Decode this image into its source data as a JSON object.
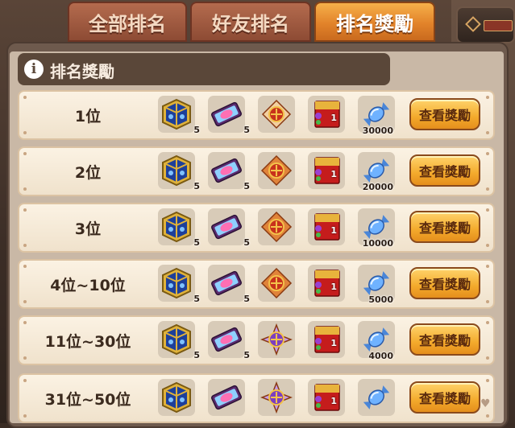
{
  "tabs": [
    {
      "label": "全部排名",
      "active": false
    },
    {
      "label": "好友排名",
      "active": false
    },
    {
      "label": "排名獎勵",
      "active": true
    }
  ],
  "header": {
    "info_icon": "i",
    "title": "排名獎勵"
  },
  "rows": [
    {
      "rank": "1位",
      "box_qty": "5",
      "ticket_qty": "5",
      "ornament": "red-circle",
      "coin": "30000",
      "button": "查看獎勵"
    },
    {
      "rank": "2位",
      "box_qty": "5",
      "ticket_qty": "5",
      "ornament": "orange-diamond",
      "coin": "20000",
      "button": "查看獎勵"
    },
    {
      "rank": "3位",
      "box_qty": "5",
      "ticket_qty": "5",
      "ornament": "orange-diamond",
      "coin": "10000",
      "button": "查看獎勵"
    },
    {
      "rank": "4位~10位",
      "box_qty": "5",
      "ticket_qty": "5",
      "ornament": "orange-diamond",
      "coin": "5000",
      "button": "查看獎勵"
    },
    {
      "rank": "11位~30位",
      "box_qty": "5",
      "ticket_qty": "5",
      "ornament": "purple-star",
      "coin": "4000",
      "button": "查看獎勵"
    },
    {
      "rank": "31位~50位",
      "box_qty": "",
      "ticket_qty": "",
      "ornament": "purple-star",
      "coin": "",
      "button": "查看獎勵"
    }
  ],
  "envelope_qty": "1",
  "icons": {
    "item_1": "blue-treasure-box-icon",
    "item_2": "pink-ticket-icon",
    "item_3": "ornament-icon",
    "item_4": "red-envelope-icon",
    "item_5": "blue-candy-icon"
  },
  "colors": {
    "active_tab": "#e2832a",
    "button": "#f3aa2c",
    "row_bg": "#fbf2e3"
  }
}
